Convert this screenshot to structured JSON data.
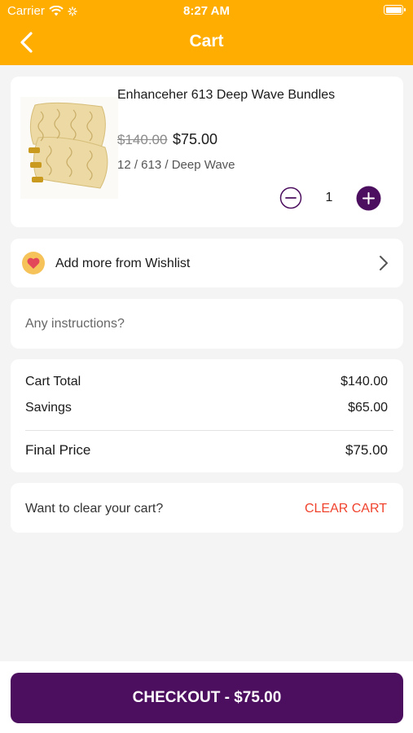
{
  "status_bar": {
    "carrier": "Carrier",
    "time": "8:27 AM"
  },
  "nav": {
    "title": "Cart",
    "back_icon": "chevron-left-icon"
  },
  "cart_item": {
    "name": "Enhanceher 613 Deep Wave Bundles",
    "original_price": "$140.00",
    "price": "$75.00",
    "variant": "12 / 613 / Deep Wave",
    "quantity": "1"
  },
  "wishlist": {
    "label": "Add more from Wishlist",
    "icon": "heart-icon"
  },
  "instructions": {
    "placeholder": "Any instructions?"
  },
  "summary": {
    "cart_total_label": "Cart Total",
    "cart_total_value": "$140.00",
    "savings_label": "Savings",
    "savings_value": "$65.00",
    "final_label": "Final Price",
    "final_value": "$75.00"
  },
  "clear": {
    "prompt": "Want to clear your cart?",
    "button_label": "CLEAR CART"
  },
  "checkout": {
    "label": "CHECKOUT - $75.00"
  },
  "colors": {
    "header": "#ffad00",
    "primary": "#4c0e5e",
    "danger": "#f0432e",
    "background": "#f4f4f4"
  }
}
